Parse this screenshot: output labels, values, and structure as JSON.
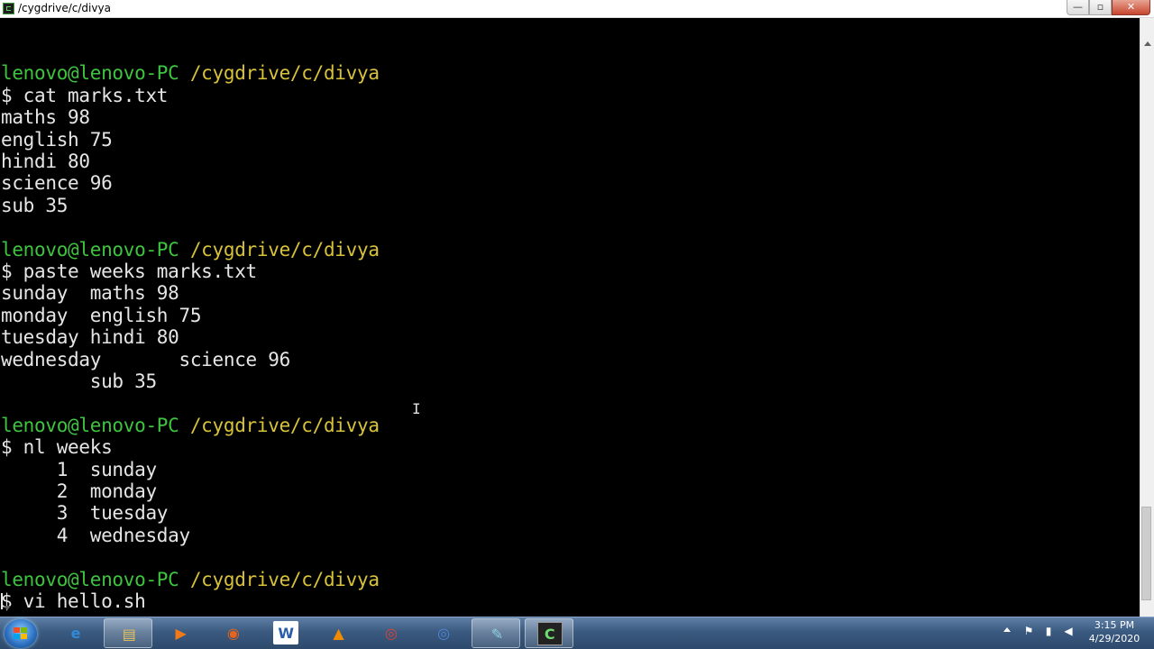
{
  "window": {
    "title": "/cygdrive/c/divya",
    "controls": {
      "minimize": "—",
      "maximize": "▫",
      "close": "✕"
    }
  },
  "terminal": {
    "prompt_user": "lenovo@lenovo-PC",
    "prompt_path": "/cygdrive/c/divya",
    "lines": [
      {
        "kind": "blank",
        "text": ""
      },
      {
        "kind": "prompt"
      },
      {
        "kind": "cmd",
        "text": "$ cat marks.txt"
      },
      {
        "kind": "out",
        "text": "maths 98"
      },
      {
        "kind": "out",
        "text": "english 75"
      },
      {
        "kind": "out",
        "text": "hindi 80"
      },
      {
        "kind": "out",
        "text": "science 96"
      },
      {
        "kind": "out",
        "text": "sub 35"
      },
      {
        "kind": "blank",
        "text": ""
      },
      {
        "kind": "prompt"
      },
      {
        "kind": "cmd",
        "text": "$ paste weeks marks.txt"
      },
      {
        "kind": "out",
        "text": "sunday  maths 98"
      },
      {
        "kind": "out",
        "text": "monday  english 75"
      },
      {
        "kind": "out",
        "text": "tuesday hindi 80"
      },
      {
        "kind": "out",
        "text": "wednesday       science 96"
      },
      {
        "kind": "out",
        "text": "        sub 35"
      },
      {
        "kind": "blank",
        "text": ""
      },
      {
        "kind": "prompt"
      },
      {
        "kind": "cmd",
        "text": "$ nl weeks"
      },
      {
        "kind": "out",
        "text": "     1  sunday"
      },
      {
        "kind": "out",
        "text": "     2  monday"
      },
      {
        "kind": "out",
        "text": "     3  tuesday"
      },
      {
        "kind": "out",
        "text": "     4  wednesday"
      },
      {
        "kind": "blank",
        "text": ""
      },
      {
        "kind": "prompt"
      },
      {
        "kind": "cmd",
        "text": "$ vi hello.sh"
      }
    ]
  },
  "taskbar": {
    "apps": [
      {
        "name": "internet-explorer",
        "icon": "e",
        "color": "#2f8ad8",
        "active": false
      },
      {
        "name": "file-explorer",
        "icon": "▤",
        "color": "#e8c45a",
        "active": true
      },
      {
        "name": "media-player",
        "icon": "▶",
        "color": "#f07a1a",
        "active": false
      },
      {
        "name": "firefox",
        "icon": "◉",
        "color": "#e8641b",
        "active": false
      },
      {
        "name": "word",
        "icon": "W",
        "color": "#2a5caa",
        "active": false
      },
      {
        "name": "vlc",
        "icon": "▲",
        "color": "#f08a00",
        "active": false
      },
      {
        "name": "chrome",
        "icon": "◎",
        "color": "#db4437",
        "active": false
      },
      {
        "name": "chromium",
        "icon": "◎",
        "color": "#4f86d8",
        "active": false
      },
      {
        "name": "notepad",
        "icon": "✎",
        "color": "#8fd0e0",
        "active": true
      },
      {
        "name": "cygwin-terminal",
        "icon": "C",
        "color": "#1e1e1e",
        "active": true
      }
    ],
    "clock": {
      "time": "3:15 PM",
      "date": "4/29/2020"
    }
  }
}
